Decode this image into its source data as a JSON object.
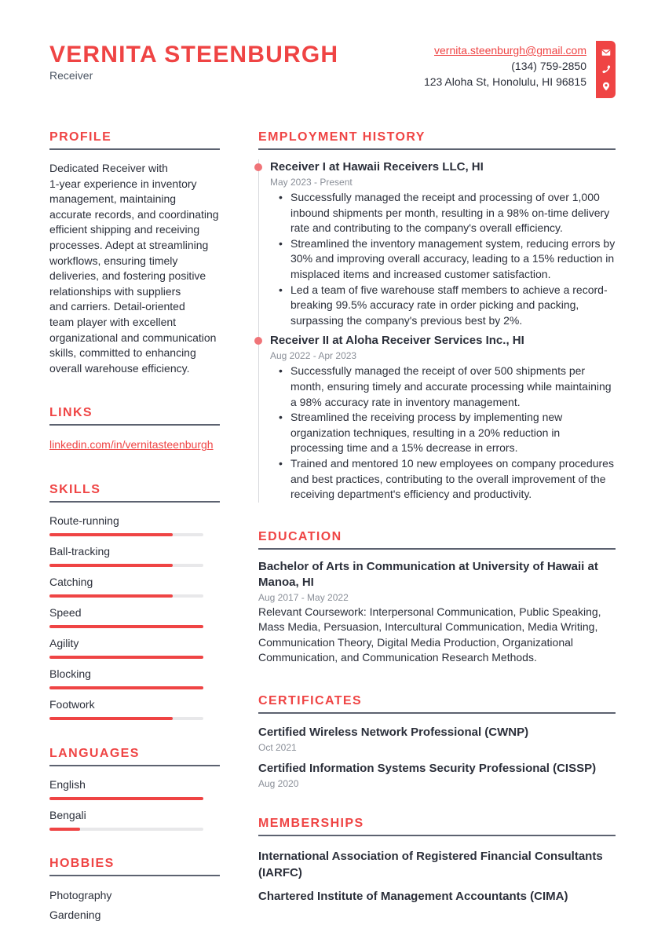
{
  "header": {
    "name": "VERNITA STEENBURGH",
    "title": "Receiver",
    "email": "vernita.steenburgh@gmail.com",
    "phone": "(134) 759-2850",
    "address": "123 Aloha St, Honolulu, HI 96815",
    "icons": [
      "envelope-icon",
      "phone-icon",
      "map-pin-icon"
    ],
    "accent_color": "#ef4444"
  },
  "profile": {
    "heading": "PROFILE",
    "lines": [
      "Dedicated Receiver with",
      "1-year experience in inventory",
      "management, maintaining",
      "accurate records, and coordinating",
      "efficient shipping and receiving",
      "processes. Adept at streamlining",
      "workflows, ensuring timely",
      "deliveries, and fostering positive",
      "relationships with suppliers",
      "and carriers. Detail-oriented",
      "team player with excellent",
      "organizational and communication",
      "skills, committed to enhancing",
      "overall warehouse efficiency."
    ]
  },
  "links": {
    "heading": "LINKS",
    "items": [
      "linkedin.com/in/vernitasteenburgh"
    ]
  },
  "skills": {
    "heading": "SKILLS",
    "items": [
      {
        "label": "Route-running",
        "level": 0.8
      },
      {
        "label": "Ball-tracking",
        "level": 0.8
      },
      {
        "label": "Catching",
        "level": 0.8
      },
      {
        "label": "Speed",
        "level": 1.0
      },
      {
        "label": "Agility",
        "level": 1.0
      },
      {
        "label": "Blocking",
        "level": 1.0
      },
      {
        "label": "Footwork",
        "level": 0.8
      }
    ]
  },
  "languages": {
    "heading": "LANGUAGES",
    "items": [
      {
        "label": "English",
        "level": 1.0
      },
      {
        "label": "Bengali",
        "level": 0.2
      }
    ]
  },
  "hobbies": {
    "heading": "HOBBIES",
    "items": [
      "Photography",
      "Gardening"
    ]
  },
  "employment": {
    "heading": "EMPLOYMENT HISTORY",
    "jobs": [
      {
        "title": "Receiver I at Hawaii Receivers LLC, HI",
        "dates": "May 2023 - Present",
        "bullets": [
          "Successfully managed the receipt and processing of over 1,000 inbound shipments per month, resulting in a 98% on-time delivery rate and contributing to the company's overall efficiency.",
          "Streamlined the inventory management system, reducing errors by 30% and improving overall accuracy, leading to a 15% reduction in misplaced items and increased customer satisfaction.",
          "Led a team of five warehouse staff members to achieve a record-breaking 99.5% accuracy rate in order picking and packing, surpassing the company's previous best by 2%."
        ]
      },
      {
        "title": "Receiver II at Aloha Receiver Services Inc., HI",
        "dates": "Aug 2022 - Apr 2023",
        "bullets": [
          "Successfully managed the receipt of over 500 shipments per month, ensuring timely and accurate processing while maintaining a 98% accuracy rate in inventory management.",
          "Streamlined the receiving process by implementing new organization techniques, resulting in a 20% reduction in processing time and a 15% decrease in errors.",
          "Trained and mentored 10 new employees on company procedures and best practices, contributing to the overall improvement of the receiving department's efficiency and productivity."
        ]
      }
    ]
  },
  "education": {
    "heading": "EDUCATION",
    "items": [
      {
        "title": "Bachelor of Arts in Communication at University of Hawaii at Manoa, HI",
        "dates": "Aug 2017 - May 2022",
        "description": "Relevant Coursework: Interpersonal Communication, Public Speaking, Mass Media, Persuasion, Intercultural Communication, Media Writing, Communication Theory, Digital Media Production, Organizational Communication, and Communication Research Methods."
      }
    ]
  },
  "certificates": {
    "heading": "CERTIFICATES",
    "items": [
      {
        "title": "Certified Wireless Network Professional (CWNP)",
        "date": "Oct 2021"
      },
      {
        "title": "Certified Information Systems Security Professional (CISSP)",
        "date": "Aug 2020"
      }
    ]
  },
  "memberships": {
    "heading": "MEMBERSHIPS",
    "items": [
      "International Association of Registered Financial Consultants (IARFC)",
      "Chartered Institute of Management Accountants (CIMA)"
    ]
  }
}
